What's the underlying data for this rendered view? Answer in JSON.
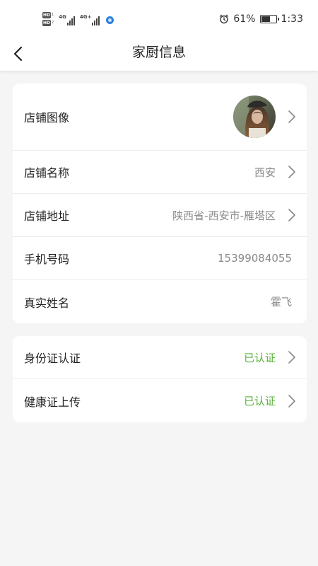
{
  "status_bar": {
    "hd_1": "HD",
    "hd_1_sub": "1",
    "hd_2": "HD",
    "hd_2_sub": "2",
    "net_1": "4G",
    "net_2": "4G+",
    "battery_percent_text": "61%",
    "battery_level": 0.61,
    "time": "1:33",
    "icons": [
      "alarm-icon",
      "battery-icon",
      "signal-icon"
    ]
  },
  "header": {
    "title": "家厨信息",
    "back_icon": "chevron-left-icon"
  },
  "info_card": {
    "rows": [
      {
        "label": "店铺图像",
        "value": "",
        "kind": "avatar",
        "arrow": true
      },
      {
        "label": "店铺名称",
        "value": "西安",
        "arrow": true
      },
      {
        "label": "店铺地址",
        "value": "陕西省-西安市-雁塔区",
        "arrow": true
      },
      {
        "label": "手机号码",
        "value": "15399084055",
        "arrow": false
      },
      {
        "label": "真实姓名",
        "value": "霍飞",
        "arrow": false
      }
    ]
  },
  "cert_card": {
    "rows": [
      {
        "label": "身份证认证",
        "value": "已认证",
        "arrow": true
      },
      {
        "label": "健康证上传",
        "value": "已认证",
        "arrow": true
      }
    ]
  },
  "colors": {
    "accent_green": "#5bb23a",
    "background": "#f5f5f5",
    "card": "#ffffff"
  }
}
